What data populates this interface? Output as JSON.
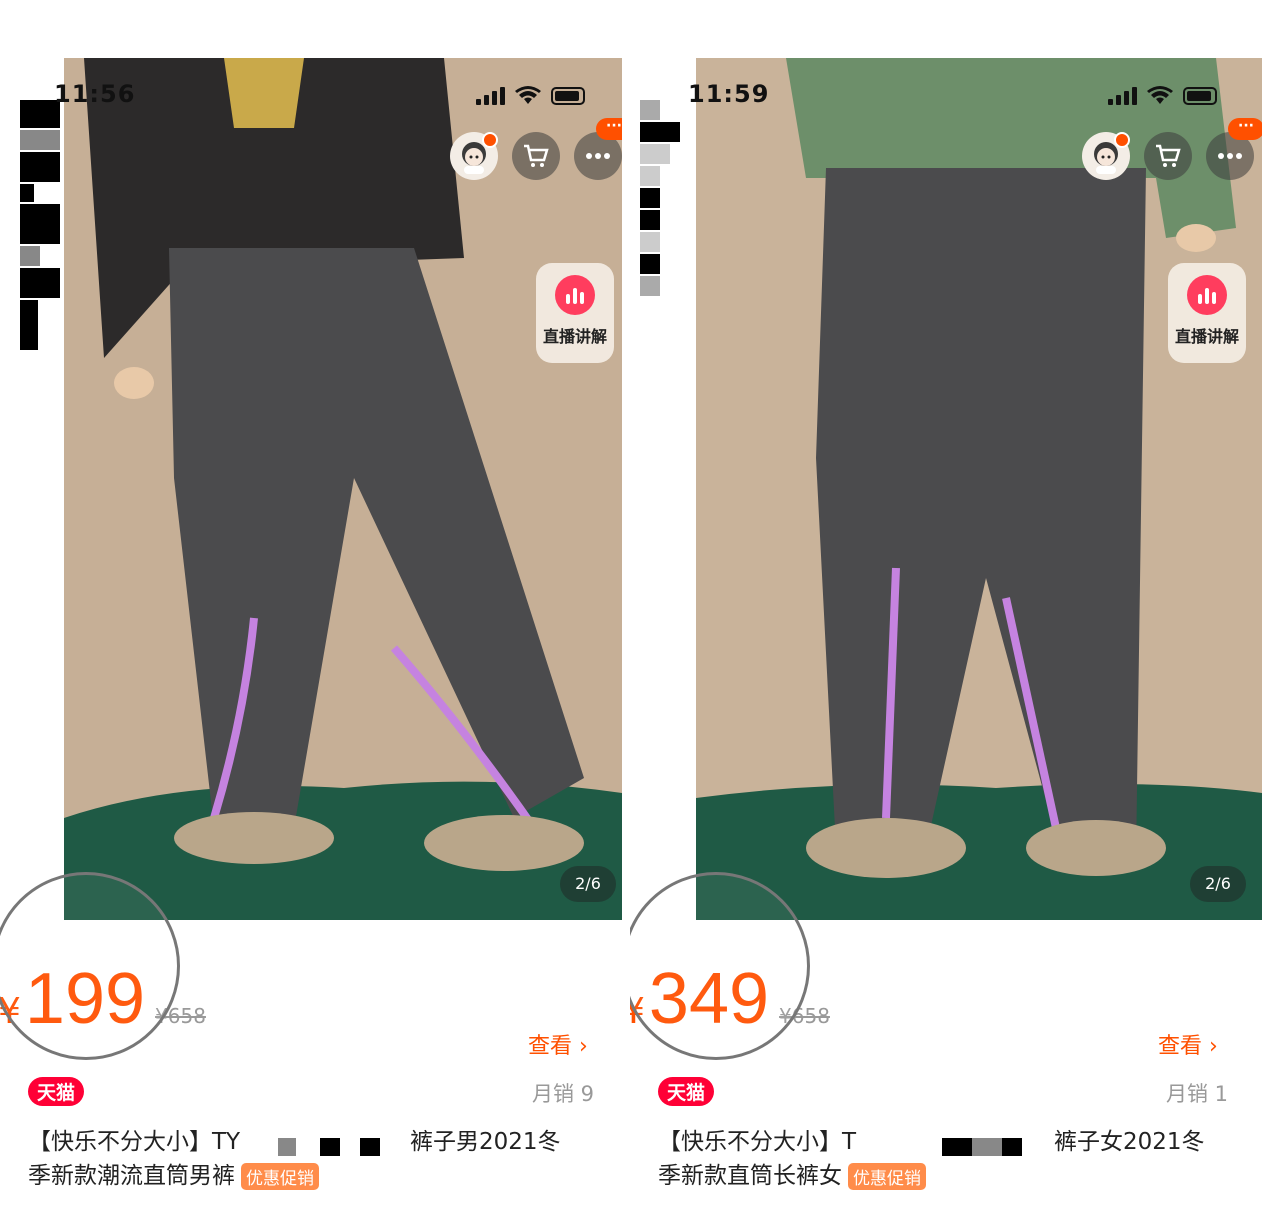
{
  "screens": [
    {
      "status_time": "11:56",
      "page_indicator": "2/6",
      "live_label": "直播讲解",
      "more_badge": "···",
      "currency": "¥",
      "price": "199",
      "original_price": "¥658",
      "view_label": "查看 ›",
      "sales": "月销 9",
      "tmall_badge": "天猫",
      "title_line1_start": "【快乐不分大小】TY",
      "title_line1_end": "裤子男2021冬",
      "title_line2": "季新款潮流直筒男裤",
      "promo_tag": "优惠促销"
    },
    {
      "status_time": "11:59",
      "page_indicator": "2/6",
      "live_label": "直播讲解",
      "more_badge": "···",
      "currency": "¥",
      "price": "349",
      "original_price": "¥658",
      "view_label": "查看 ›",
      "sales": "月销 1",
      "tmall_badge": "天猫",
      "title_line1_start": "【快乐不分大小】T",
      "title_line1_end": "裤子女2021冬",
      "title_line2": "季新款直筒长裤女",
      "promo_tag": "优惠促销"
    }
  ],
  "colors": {
    "accent": "#ff5000",
    "tmall": "#ff0036",
    "promo": "#ff8c4a",
    "pants": "#4b4b4d",
    "zipper": "#c583e0",
    "floor": "#1f5a45",
    "wall": "#c9b39a"
  },
  "icons": [
    "signal-icon",
    "wifi-icon",
    "battery-icon",
    "avatar-icon",
    "cart-icon",
    "more-icon",
    "live-chart-icon"
  ]
}
